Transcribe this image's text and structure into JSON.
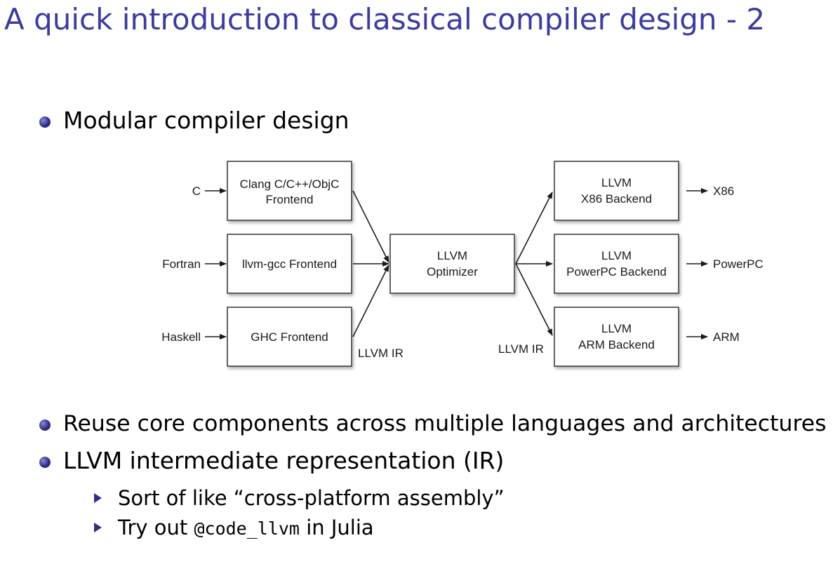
{
  "slide": {
    "title": "A quick introduction to classical compiler design - 2",
    "bullets": [
      {
        "text": "Modular compiler design"
      },
      {
        "text": "Reuse core components across multiple languages and architectures"
      },
      {
        "text": "LLVM intermediate representation (IR)"
      }
    ],
    "sub_bullets": [
      {
        "before": "Sort of like “cross-platform assembly”",
        "code": "",
        "after": ""
      },
      {
        "before": "Try out ",
        "code": "@code_llvm",
        "after": " in Julia"
      }
    ]
  },
  "diagram": {
    "inputs": [
      "C",
      "Fortran",
      "Haskell"
    ],
    "frontends": [
      {
        "line1": "Clang C/C++/ObjC",
        "line2": "Frontend"
      },
      {
        "line1": "llvm-gcc Frontend",
        "line2": ""
      },
      {
        "line1": "GHC Frontend",
        "line2": ""
      }
    ],
    "optimizer": {
      "line1": "LLVM",
      "line2": "Optimizer"
    },
    "backends": [
      {
        "line1": "LLVM",
        "line2": "X86 Backend"
      },
      {
        "line1": "LLVM",
        "line2": "PowerPC Backend"
      },
      {
        "line1": "LLVM",
        "line2": "ARM Backend"
      }
    ],
    "outputs": [
      "X86",
      "PowerPC",
      "ARM"
    ],
    "ir_label_left": "LLVM IR",
    "ir_label_right": "LLVM IR"
  },
  "colors": {
    "title": "#3c3ca0",
    "bullet": "#2e2e8c",
    "text": "#000000",
    "box_fill": "#ffffff",
    "box_stroke": "#333333",
    "box_shadow": "#b0b0b0"
  }
}
